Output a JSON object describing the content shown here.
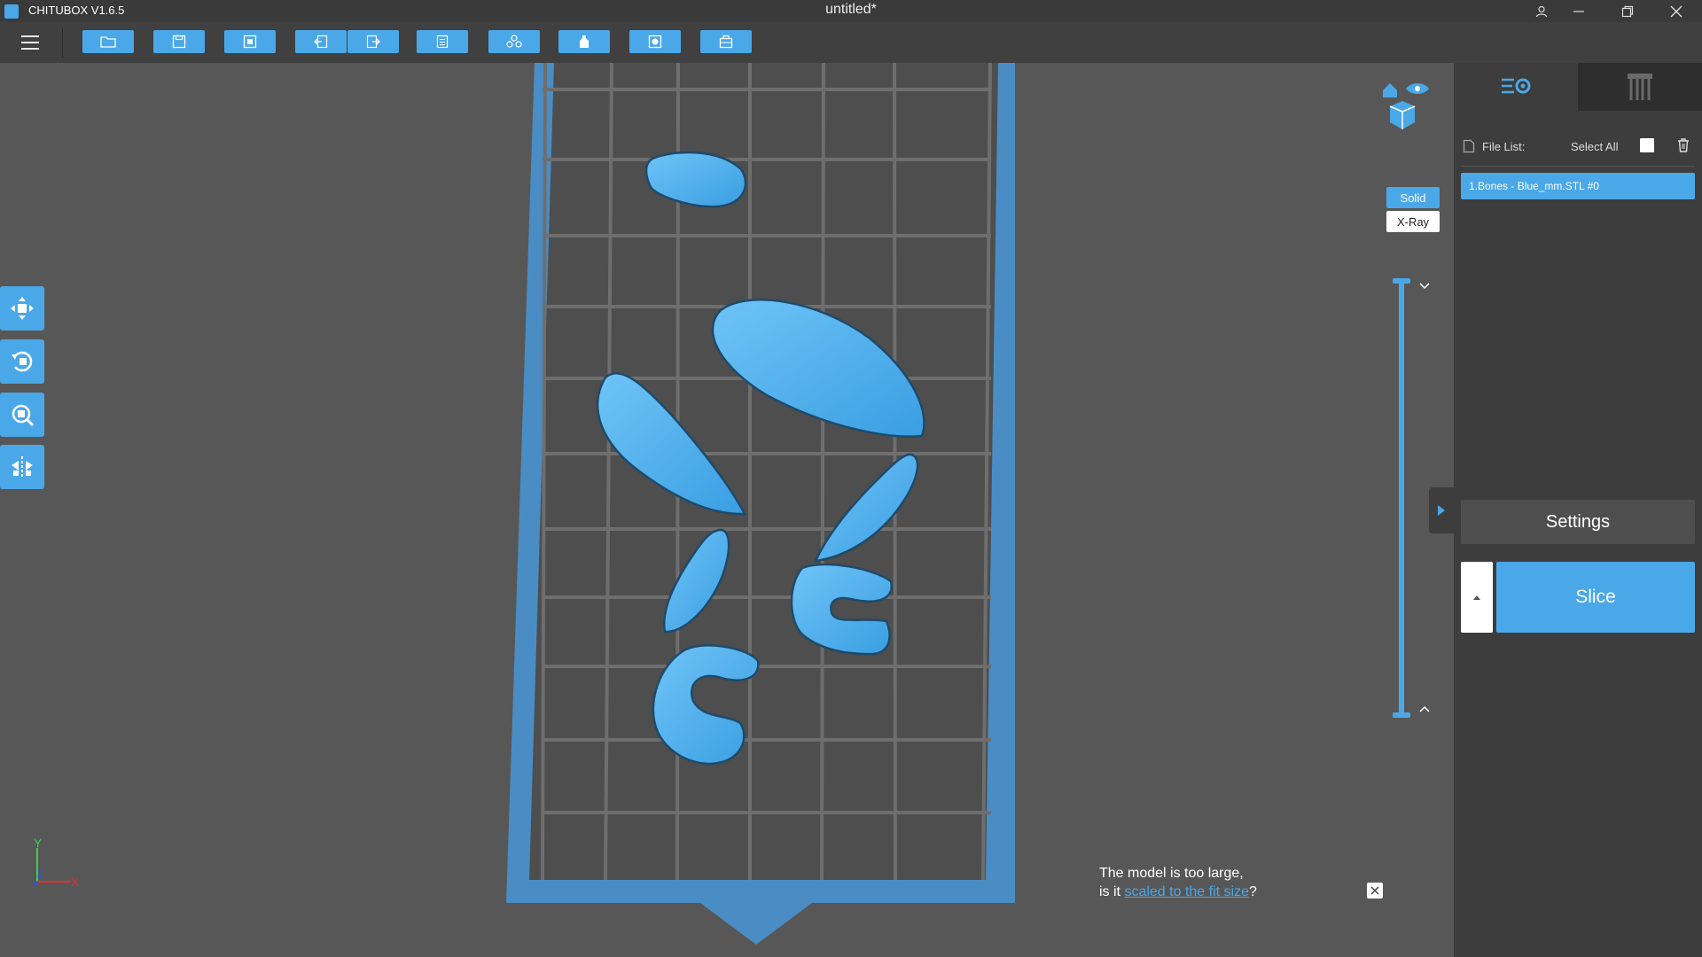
{
  "window": {
    "app_name": "CHITUBOX V1.6.5",
    "doc_title": "untitled*"
  },
  "toolbar": {
    "buttons": [
      {
        "name": "open-file-button",
        "icon": "folder-icon"
      },
      {
        "name": "save-file-button",
        "icon": "save-icon"
      },
      {
        "name": "auto-layout-button",
        "icon": "layout-icon"
      },
      {
        "name": "undo-button",
        "icon": "undo-icon"
      },
      {
        "name": "redo-button",
        "icon": "redo-icon"
      },
      {
        "name": "settings-file-button",
        "icon": "list-icon"
      },
      {
        "name": "supports-button",
        "icon": "supports-icon"
      },
      {
        "name": "hollow-button",
        "icon": "bottle-icon"
      },
      {
        "name": "drill-hole-button",
        "icon": "hole-icon"
      },
      {
        "name": "add-button",
        "icon": "box-icon"
      }
    ]
  },
  "viewport": {
    "render_modes": {
      "solid": "Solid",
      "xray": "X-Ray",
      "active": "Solid"
    },
    "layer_slider": {
      "value": 1.0
    },
    "axes": {
      "x": "X",
      "y": "Y",
      "z": "Z"
    },
    "notice": {
      "line1": "The model is too large,",
      "line2_prefix": "is it ",
      "link": "scaled to the fit size",
      "line2_suffix": "?"
    }
  },
  "left_tools": [
    {
      "name": "move-tool-button",
      "icon": "move-icon"
    },
    {
      "name": "rotate-tool-button",
      "icon": "rotate-icon"
    },
    {
      "name": "scale-tool-button",
      "icon": "scale-icon"
    },
    {
      "name": "mirror-tool-button",
      "icon": "mirror-icon"
    }
  ],
  "right_panel": {
    "tabs": [
      "settings-tab",
      "supports-tab"
    ],
    "file_list_label": "File List:",
    "select_all_label": "Select All",
    "files": [
      "1.Bones - Blue_mm.STL #0"
    ],
    "settings_label": "Settings",
    "slice_label": "Slice"
  },
  "colors": {
    "accent": "#4aa8e8",
    "model": "#4fb1f0",
    "background": "#575757",
    "panel": "#3d3d3d"
  }
}
